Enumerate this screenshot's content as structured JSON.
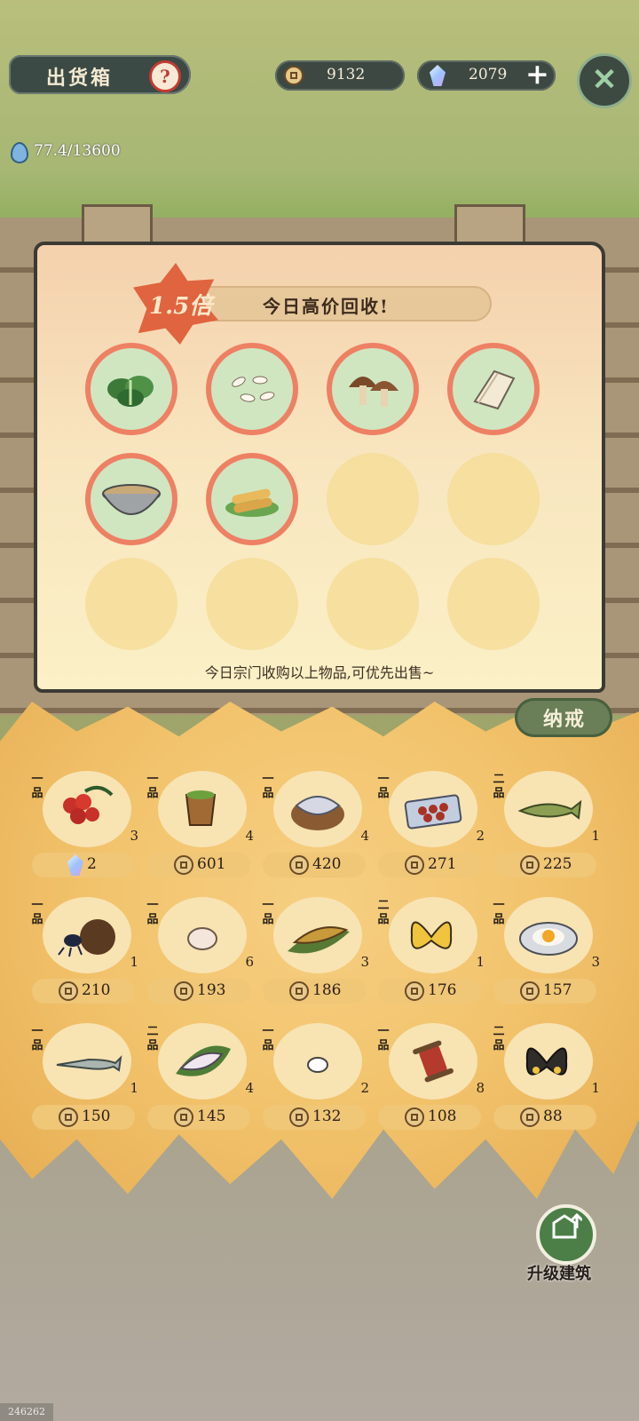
{
  "header": {
    "title": "出货箱",
    "help_glyph": "?",
    "coins": "9132",
    "gems": "2079",
    "plus_glyph": "+",
    "close_glyph": "✕",
    "water": "77.4/13600"
  },
  "board": {
    "multiplier": "1.5倍",
    "banner": "今日高价回收!",
    "note": "今日宗门收购以上物品,可优先出售~",
    "high_price_items": [
      {
        "icon": "bok-choy-icon"
      },
      {
        "icon": "rice-grains-icon"
      },
      {
        "icon": "mushroom-icon"
      },
      {
        "icon": "tofu-skin-icon"
      },
      {
        "icon": "soup-bowl-icon"
      },
      {
        "icon": "spring-roll-icon"
      }
    ]
  },
  "bag": {
    "tab_label": "纳戒",
    "items": [
      {
        "grade": "一品",
        "icon": "berries-icon",
        "qty": "3",
        "price": "2",
        "currency": "gem"
      },
      {
        "grade": "一品",
        "icon": "tea-cup-icon",
        "qty": "4",
        "price": "601",
        "currency": "coin"
      },
      {
        "grade": "一品",
        "icon": "fish-cutting-board-icon",
        "qty": "4",
        "price": "420",
        "currency": "coin"
      },
      {
        "grade": "一品",
        "icon": "meatball-plate-icon",
        "qty": "2",
        "price": "271",
        "currency": "coin"
      },
      {
        "grade": "二品",
        "icon": "pike-fish-icon",
        "qty": "1",
        "price": "225",
        "currency": "coin"
      },
      {
        "grade": "一品",
        "icon": "dung-beetle-icon",
        "qty": "1",
        "price": "210",
        "currency": "coin"
      },
      {
        "grade": "一品",
        "icon": "egg-icon",
        "qty": "6",
        "price": "193",
        "currency": "coin"
      },
      {
        "grade": "一品",
        "icon": "grilled-fish-leaf-icon",
        "qty": "3",
        "price": "186",
        "currency": "coin"
      },
      {
        "grade": "二品",
        "icon": "yellow-butterfly-icon",
        "qty": "1",
        "price": "176",
        "currency": "coin"
      },
      {
        "grade": "一品",
        "icon": "fried-egg-icon",
        "qty": "3",
        "price": "157",
        "currency": "coin"
      },
      {
        "grade": "一品",
        "icon": "gar-fish-icon",
        "qty": "1",
        "price": "150",
        "currency": "coin"
      },
      {
        "grade": "二品",
        "icon": "fish-fillet-icon",
        "qty": "4",
        "price": "145",
        "currency": "coin"
      },
      {
        "grade": "一品",
        "icon": "small-egg-icon",
        "qty": "2",
        "price": "132",
        "currency": "coin"
      },
      {
        "grade": "一品",
        "icon": "thread-spool-icon",
        "qty": "8",
        "price": "108",
        "currency": "coin"
      },
      {
        "grade": "二品",
        "icon": "dark-butterfly-icon",
        "qty": "1",
        "price": "88",
        "currency": "coin"
      }
    ]
  },
  "upgrade": {
    "label": "升级建筑"
  },
  "corner_tag": "246262"
}
